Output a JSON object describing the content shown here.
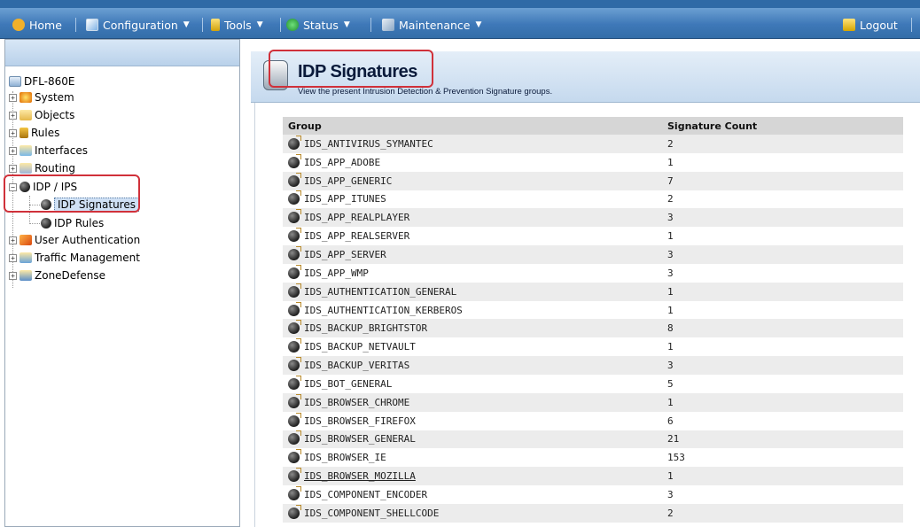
{
  "menu": {
    "home": "Home",
    "configuration": "Configuration",
    "tools": "Tools",
    "status": "Status",
    "maintenance": "Maintenance",
    "logout": "Logout"
  },
  "tree": {
    "root": "DFL-860E",
    "items": [
      {
        "label": "System"
      },
      {
        "label": "Objects"
      },
      {
        "label": "Rules"
      },
      {
        "label": "Interfaces"
      },
      {
        "label": "Routing"
      },
      {
        "label": "IDP / IPS"
      },
      {
        "label": "IDP Signatures"
      },
      {
        "label": "IDP Rules"
      },
      {
        "label": "User Authentication"
      },
      {
        "label": "Traffic Management"
      },
      {
        "label": "ZoneDefense"
      }
    ]
  },
  "header": {
    "title": "IDP Signatures",
    "description": "View the present Intrusion Detection & Prevention Signature groups."
  },
  "table": {
    "columns": [
      "Group",
      "Signature Count"
    ],
    "rows": [
      [
        "IDS_ANTIVIRUS_SYMANTEC",
        "2"
      ],
      [
        "IDS_APP_ADOBE",
        "1"
      ],
      [
        "IDS_APP_GENERIC",
        "7"
      ],
      [
        "IDS_APP_ITUNES",
        "2"
      ],
      [
        "IDS_APP_REALPLAYER",
        "3"
      ],
      [
        "IDS_APP_REALSERVER",
        "1"
      ],
      [
        "IDS_APP_SERVER",
        "3"
      ],
      [
        "IDS_APP_WMP",
        "3"
      ],
      [
        "IDS_AUTHENTICATION_GENERAL",
        "1"
      ],
      [
        "IDS_AUTHENTICATION_KERBEROS",
        "1"
      ],
      [
        "IDS_BACKUP_BRIGHTSTOR",
        "8"
      ],
      [
        "IDS_BACKUP_NETVAULT",
        "1"
      ],
      [
        "IDS_BACKUP_VERITAS",
        "3"
      ],
      [
        "IDS_BOT_GENERAL",
        "5"
      ],
      [
        "IDS_BROWSER_CHROME",
        "1"
      ],
      [
        "IDS_BROWSER_FIREFOX",
        "6"
      ],
      [
        "IDS_BROWSER_GENERAL",
        "21"
      ],
      [
        "IDS_BROWSER_IE",
        "153"
      ],
      [
        "IDS_BROWSER_MOZILLA",
        "1"
      ],
      [
        "IDS_COMPONENT_ENCODER",
        "3"
      ],
      [
        "IDS_COMPONENT_SHELLCODE",
        "2"
      ]
    ]
  },
  "colors": {
    "menubar": "#3e78b8",
    "highlight": "#d0313a",
    "row_alt": "#ececec",
    "header_bg": "#d6d6d6"
  }
}
